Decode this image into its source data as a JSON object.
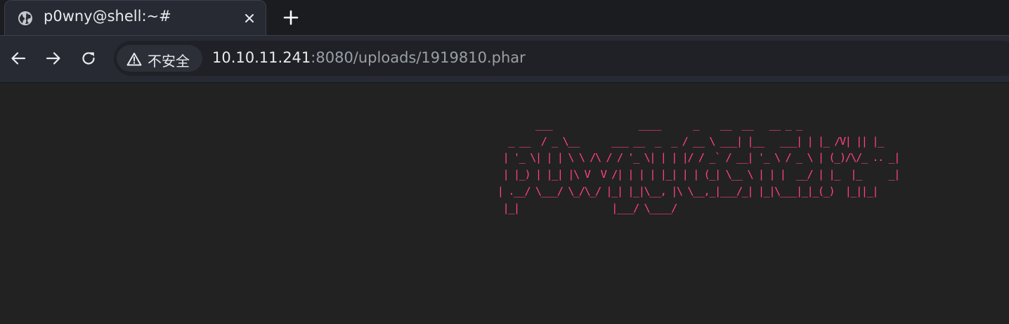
{
  "tab": {
    "title": "p0wny@shell:~#",
    "close_icon": "close-icon",
    "globe_icon": "globe-icon"
  },
  "new_tab_icon": "plus-icon",
  "nav": {
    "back_icon": "arrow-left-icon",
    "forward_icon": "arrow-right-icon",
    "reload_icon": "reload-icon"
  },
  "omnibox": {
    "security_icon": "warning-triangle-icon",
    "security_label": "不安全",
    "url_host": "10.10.11.241",
    "url_path": ":8080/uploads/1919810.phar"
  },
  "page": {
    "banner": "        ___                ____      _    __  __   __ _ _\n   _ __  / _ \\__      ___ __  _  _ / __ \\ ___| |__   ___| | |_ /V| || |_\n  | '_ \\| | | \\ \\ /\\ / / '_ \\| | | |/ / _` / __| '_ \\ / _ \\ | (_)/\\/_ .. _|\n  | |_) | |_| |\\ V  V /| | | | |_| | | (_| \\__ \\ | | |  __/ | |_  |_     _|\n | .__/ \\___/ \\_/\\_/ |_| |_|\\__, |\\ \\__,_|___/_| |_|\\___|_|_(_)  |_||_|\n  |_|                 |___/ \\____/"
  },
  "colors": {
    "tab_bar": "#1b1c20",
    "toolbar": "#272a33",
    "page_bg": "#222222",
    "banner_text": "#ff4180",
    "url_host": "#e8eaed",
    "url_path": "#9aa0a6"
  }
}
